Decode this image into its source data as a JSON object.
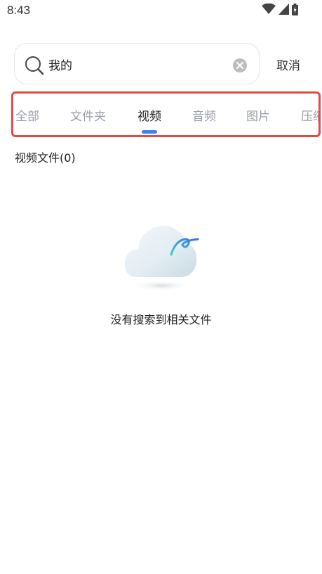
{
  "status_bar": {
    "time": "8:43",
    "icons": [
      "wifi-icon",
      "cell-signal-icon",
      "battery-icon"
    ]
  },
  "search": {
    "query": "我的",
    "cancel_label": "取消"
  },
  "tabs": {
    "items": [
      {
        "label": "全部",
        "active": false
      },
      {
        "label": "文件夹",
        "active": false
      },
      {
        "label": "视频",
        "active": true
      },
      {
        "label": "音频",
        "active": false
      },
      {
        "label": "图片",
        "active": false
      },
      {
        "label": "压缩",
        "active": false
      }
    ]
  },
  "section": {
    "title": "视频文件(0)"
  },
  "empty_state": {
    "message": "没有搜索到相关文件",
    "illustration": "cloud-icon"
  },
  "colors": {
    "accent": "#3b82f6",
    "highlight_border": "#e24a4a",
    "inactive_tab": "#9aa0a8",
    "active_tab": "#222222"
  }
}
